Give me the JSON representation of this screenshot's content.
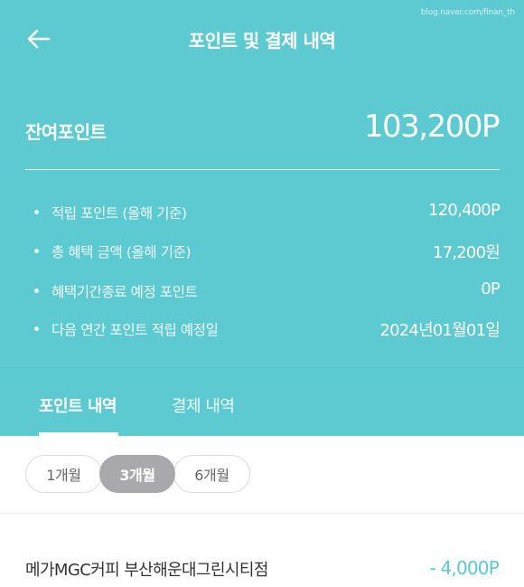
{
  "watermark": "blog.naver.com/finan_th",
  "header": {
    "title": "포인트 및 결제 내역",
    "back_icon": "back-arrow-icon"
  },
  "colors": {
    "accent": "#5dc9d0",
    "pill_active": "#a9a9ad",
    "text_dark": "#333333"
  },
  "balance": {
    "label": "잔여포인트",
    "value": "103,200P"
  },
  "summary": [
    {
      "label": "적립 포인트 (올해 기준)",
      "value": "120,400P"
    },
    {
      "label": "총 혜택 금액 (올해 기준)",
      "value": "17,200원"
    },
    {
      "label": "혜택기간종료 예정 포인트",
      "value": "0P"
    },
    {
      "label": "다음 연간 포인트 적립 예정일",
      "value": "2024년01월01일"
    }
  ],
  "tabs": [
    {
      "label": "포인트 내역",
      "active": true
    },
    {
      "label": "결제 내역",
      "active": false
    }
  ],
  "period_filters": [
    {
      "label": "1개월",
      "selected": false
    },
    {
      "label": "3개월",
      "selected": true
    },
    {
      "label": "6개월",
      "selected": false
    }
  ],
  "transactions": [
    {
      "name": "메가MGC커피 부산해운대그린시티점",
      "amount": "- 4,000P"
    }
  ]
}
